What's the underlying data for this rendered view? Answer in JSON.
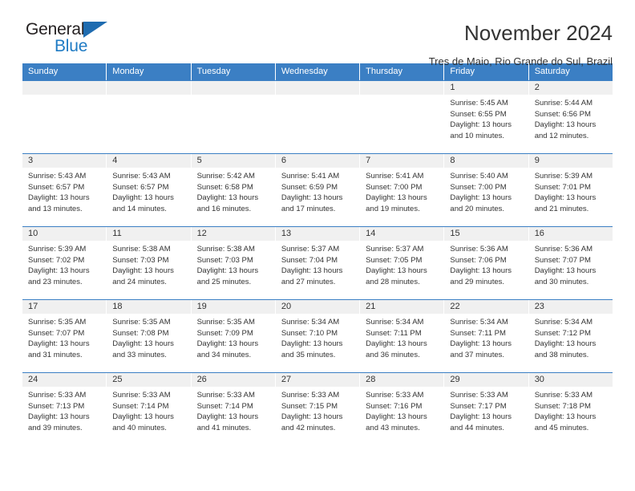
{
  "brand": {
    "name_part1": "General",
    "name_part2": "Blue",
    "triangle_color": "#1f6cb0",
    "blue_color": "#1f7bc4"
  },
  "header": {
    "title": "November 2024",
    "subtitle": "Tres de Maio, Rio Grande do Sul, Brazil"
  },
  "calendar": {
    "header_bg": "#3b7fc4",
    "daynum_bg": "#f0f0f0",
    "weekdays": [
      "Sunday",
      "Monday",
      "Tuesday",
      "Wednesday",
      "Thursday",
      "Friday",
      "Saturday"
    ],
    "weeks": [
      [
        {
          "day": "",
          "empty": true
        },
        {
          "day": "",
          "empty": true
        },
        {
          "day": "",
          "empty": true
        },
        {
          "day": "",
          "empty": true
        },
        {
          "day": "",
          "empty": true
        },
        {
          "day": "1",
          "sunrise": "Sunrise: 5:45 AM",
          "sunset": "Sunset: 6:55 PM",
          "daylight1": "Daylight: 13 hours",
          "daylight2": "and 10 minutes."
        },
        {
          "day": "2",
          "sunrise": "Sunrise: 5:44 AM",
          "sunset": "Sunset: 6:56 PM",
          "daylight1": "Daylight: 13 hours",
          "daylight2": "and 12 minutes."
        }
      ],
      [
        {
          "day": "3",
          "sunrise": "Sunrise: 5:43 AM",
          "sunset": "Sunset: 6:57 PM",
          "daylight1": "Daylight: 13 hours",
          "daylight2": "and 13 minutes."
        },
        {
          "day": "4",
          "sunrise": "Sunrise: 5:43 AM",
          "sunset": "Sunset: 6:57 PM",
          "daylight1": "Daylight: 13 hours",
          "daylight2": "and 14 minutes."
        },
        {
          "day": "5",
          "sunrise": "Sunrise: 5:42 AM",
          "sunset": "Sunset: 6:58 PM",
          "daylight1": "Daylight: 13 hours",
          "daylight2": "and 16 minutes."
        },
        {
          "day": "6",
          "sunrise": "Sunrise: 5:41 AM",
          "sunset": "Sunset: 6:59 PM",
          "daylight1": "Daylight: 13 hours",
          "daylight2": "and 17 minutes."
        },
        {
          "day": "7",
          "sunrise": "Sunrise: 5:41 AM",
          "sunset": "Sunset: 7:00 PM",
          "daylight1": "Daylight: 13 hours",
          "daylight2": "and 19 minutes."
        },
        {
          "day": "8",
          "sunrise": "Sunrise: 5:40 AM",
          "sunset": "Sunset: 7:00 PM",
          "daylight1": "Daylight: 13 hours",
          "daylight2": "and 20 minutes."
        },
        {
          "day": "9",
          "sunrise": "Sunrise: 5:39 AM",
          "sunset": "Sunset: 7:01 PM",
          "daylight1": "Daylight: 13 hours",
          "daylight2": "and 21 minutes."
        }
      ],
      [
        {
          "day": "10",
          "sunrise": "Sunrise: 5:39 AM",
          "sunset": "Sunset: 7:02 PM",
          "daylight1": "Daylight: 13 hours",
          "daylight2": "and 23 minutes."
        },
        {
          "day": "11",
          "sunrise": "Sunrise: 5:38 AM",
          "sunset": "Sunset: 7:03 PM",
          "daylight1": "Daylight: 13 hours",
          "daylight2": "and 24 minutes."
        },
        {
          "day": "12",
          "sunrise": "Sunrise: 5:38 AM",
          "sunset": "Sunset: 7:03 PM",
          "daylight1": "Daylight: 13 hours",
          "daylight2": "and 25 minutes."
        },
        {
          "day": "13",
          "sunrise": "Sunrise: 5:37 AM",
          "sunset": "Sunset: 7:04 PM",
          "daylight1": "Daylight: 13 hours",
          "daylight2": "and 27 minutes."
        },
        {
          "day": "14",
          "sunrise": "Sunrise: 5:37 AM",
          "sunset": "Sunset: 7:05 PM",
          "daylight1": "Daylight: 13 hours",
          "daylight2": "and 28 minutes."
        },
        {
          "day": "15",
          "sunrise": "Sunrise: 5:36 AM",
          "sunset": "Sunset: 7:06 PM",
          "daylight1": "Daylight: 13 hours",
          "daylight2": "and 29 minutes."
        },
        {
          "day": "16",
          "sunrise": "Sunrise: 5:36 AM",
          "sunset": "Sunset: 7:07 PM",
          "daylight1": "Daylight: 13 hours",
          "daylight2": "and 30 minutes."
        }
      ],
      [
        {
          "day": "17",
          "sunrise": "Sunrise: 5:35 AM",
          "sunset": "Sunset: 7:07 PM",
          "daylight1": "Daylight: 13 hours",
          "daylight2": "and 31 minutes."
        },
        {
          "day": "18",
          "sunrise": "Sunrise: 5:35 AM",
          "sunset": "Sunset: 7:08 PM",
          "daylight1": "Daylight: 13 hours",
          "daylight2": "and 33 minutes."
        },
        {
          "day": "19",
          "sunrise": "Sunrise: 5:35 AM",
          "sunset": "Sunset: 7:09 PM",
          "daylight1": "Daylight: 13 hours",
          "daylight2": "and 34 minutes."
        },
        {
          "day": "20",
          "sunrise": "Sunrise: 5:34 AM",
          "sunset": "Sunset: 7:10 PM",
          "daylight1": "Daylight: 13 hours",
          "daylight2": "and 35 minutes."
        },
        {
          "day": "21",
          "sunrise": "Sunrise: 5:34 AM",
          "sunset": "Sunset: 7:11 PM",
          "daylight1": "Daylight: 13 hours",
          "daylight2": "and 36 minutes."
        },
        {
          "day": "22",
          "sunrise": "Sunrise: 5:34 AM",
          "sunset": "Sunset: 7:11 PM",
          "daylight1": "Daylight: 13 hours",
          "daylight2": "and 37 minutes."
        },
        {
          "day": "23",
          "sunrise": "Sunrise: 5:34 AM",
          "sunset": "Sunset: 7:12 PM",
          "daylight1": "Daylight: 13 hours",
          "daylight2": "and 38 minutes."
        }
      ],
      [
        {
          "day": "24",
          "sunrise": "Sunrise: 5:33 AM",
          "sunset": "Sunset: 7:13 PM",
          "daylight1": "Daylight: 13 hours",
          "daylight2": "and 39 minutes."
        },
        {
          "day": "25",
          "sunrise": "Sunrise: 5:33 AM",
          "sunset": "Sunset: 7:14 PM",
          "daylight1": "Daylight: 13 hours",
          "daylight2": "and 40 minutes."
        },
        {
          "day": "26",
          "sunrise": "Sunrise: 5:33 AM",
          "sunset": "Sunset: 7:14 PM",
          "daylight1": "Daylight: 13 hours",
          "daylight2": "and 41 minutes."
        },
        {
          "day": "27",
          "sunrise": "Sunrise: 5:33 AM",
          "sunset": "Sunset: 7:15 PM",
          "daylight1": "Daylight: 13 hours",
          "daylight2": "and 42 minutes."
        },
        {
          "day": "28",
          "sunrise": "Sunrise: 5:33 AM",
          "sunset": "Sunset: 7:16 PM",
          "daylight1": "Daylight: 13 hours",
          "daylight2": "and 43 minutes."
        },
        {
          "day": "29",
          "sunrise": "Sunrise: 5:33 AM",
          "sunset": "Sunset: 7:17 PM",
          "daylight1": "Daylight: 13 hours",
          "daylight2": "and 44 minutes."
        },
        {
          "day": "30",
          "sunrise": "Sunrise: 5:33 AM",
          "sunset": "Sunset: 7:18 PM",
          "daylight1": "Daylight: 13 hours",
          "daylight2": "and 45 minutes."
        }
      ]
    ]
  }
}
